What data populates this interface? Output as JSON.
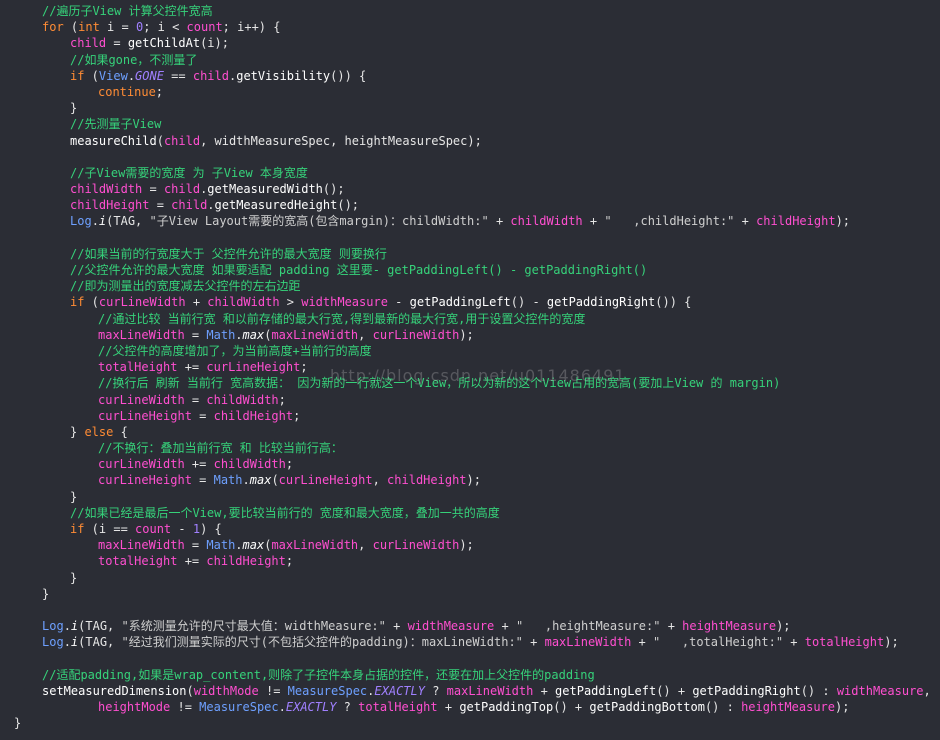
{
  "editor": {
    "watermark": "http://blog.csdn.net/u011486491",
    "lines": [
      {
        "indent": 1,
        "tokens": [
          {
            "t": "cmt",
            "v": "//遍历子View 计算父控件宽高"
          }
        ]
      },
      {
        "indent": 1,
        "tokens": [
          {
            "t": "kw",
            "v": "for"
          },
          {
            "t": "punc",
            "v": " ("
          },
          {
            "t": "kw",
            "v": "int"
          },
          {
            "t": "punc",
            "v": " i = "
          },
          {
            "t": "num",
            "v": "0"
          },
          {
            "t": "punc",
            "v": "; i < "
          },
          {
            "t": "var",
            "v": "count"
          },
          {
            "t": "punc",
            "v": "; i++) {"
          }
        ]
      },
      {
        "indent": 2,
        "tokens": [
          {
            "t": "var",
            "v": "child"
          },
          {
            "t": "punc",
            "v": " = "
          },
          {
            "t": "fn",
            "v": "getChildAt"
          },
          {
            "t": "punc",
            "v": "(i);"
          }
        ]
      },
      {
        "indent": 2,
        "tokens": [
          {
            "t": "cmt",
            "v": "//如果gone，不测量了"
          }
        ]
      },
      {
        "indent": 2,
        "tokens": [
          {
            "t": "kw",
            "v": "if"
          },
          {
            "t": "punc",
            "v": " ("
          },
          {
            "t": "cls",
            "v": "View"
          },
          {
            "t": "punc",
            "v": "."
          },
          {
            "t": "const",
            "v": "GONE"
          },
          {
            "t": "punc",
            "v": " == "
          },
          {
            "t": "var",
            "v": "child"
          },
          {
            "t": "punc",
            "v": "."
          },
          {
            "t": "fn",
            "v": "getVisibility"
          },
          {
            "t": "punc",
            "v": "()) {"
          }
        ]
      },
      {
        "indent": 3,
        "tokens": [
          {
            "t": "kw",
            "v": "continue"
          },
          {
            "t": "punc",
            "v": ";"
          }
        ]
      },
      {
        "indent": 2,
        "tokens": [
          {
            "t": "punc",
            "v": "}"
          }
        ]
      },
      {
        "indent": 2,
        "tokens": [
          {
            "t": "cmt",
            "v": "//先测量子View"
          }
        ]
      },
      {
        "indent": 2,
        "tokens": [
          {
            "t": "fn",
            "v": "measureChild"
          },
          {
            "t": "punc",
            "v": "("
          },
          {
            "t": "var",
            "v": "child"
          },
          {
            "t": "punc",
            "v": ", widthMeasureSpec, heightMeasureSpec);"
          }
        ]
      },
      {
        "indent": 2,
        "tokens": []
      },
      {
        "indent": 2,
        "tokens": [
          {
            "t": "cmt",
            "v": "//子View需要的宽度 为 子View 本身宽度"
          }
        ]
      },
      {
        "indent": 2,
        "tokens": [
          {
            "t": "var",
            "v": "childWidth"
          },
          {
            "t": "punc",
            "v": " = "
          },
          {
            "t": "var",
            "v": "child"
          },
          {
            "t": "punc",
            "v": "."
          },
          {
            "t": "fn",
            "v": "getMeasuredWidth"
          },
          {
            "t": "punc",
            "v": "();"
          }
        ]
      },
      {
        "indent": 2,
        "tokens": [
          {
            "t": "var",
            "v": "childHeight"
          },
          {
            "t": "punc",
            "v": " = "
          },
          {
            "t": "var",
            "v": "child"
          },
          {
            "t": "punc",
            "v": "."
          },
          {
            "t": "fn",
            "v": "getMeasuredHeight"
          },
          {
            "t": "punc",
            "v": "();"
          }
        ]
      },
      {
        "indent": 2,
        "tokens": [
          {
            "t": "cls",
            "v": "Log"
          },
          {
            "t": "punc",
            "v": "."
          },
          {
            "t": "fnit",
            "v": "i"
          },
          {
            "t": "punc",
            "v": "(TAG, "
          },
          {
            "t": "str",
            "v": "\"子View Layout需要的宽高(包含margin)：childWidth:\""
          },
          {
            "t": "punc",
            "v": " + "
          },
          {
            "t": "var",
            "v": "childWidth"
          },
          {
            "t": "punc",
            "v": " + "
          },
          {
            "t": "str",
            "v": "\"   ,childHeight:\""
          },
          {
            "t": "punc",
            "v": " + "
          },
          {
            "t": "var",
            "v": "childHeight"
          },
          {
            "t": "punc",
            "v": ");"
          }
        ]
      },
      {
        "indent": 2,
        "tokens": []
      },
      {
        "indent": 2,
        "tokens": [
          {
            "t": "cmt",
            "v": "//如果当前的行宽度大于 父控件允许的最大宽度 则要换行"
          }
        ]
      },
      {
        "indent": 2,
        "tokens": [
          {
            "t": "cmt",
            "v": "//父控件允许的最大宽度 如果要适配 padding 这里要- getPaddingLeft() - getPaddingRight()"
          }
        ]
      },
      {
        "indent": 2,
        "tokens": [
          {
            "t": "cmt",
            "v": "//即为测量出的宽度减去父控件的左右边距"
          }
        ]
      },
      {
        "indent": 2,
        "tokens": [
          {
            "t": "kw",
            "v": "if"
          },
          {
            "t": "punc",
            "v": " ("
          },
          {
            "t": "var",
            "v": "curLineWidth"
          },
          {
            "t": "punc",
            "v": " + "
          },
          {
            "t": "var",
            "v": "childWidth"
          },
          {
            "t": "punc",
            "v": " > "
          },
          {
            "t": "var",
            "v": "widthMeasure"
          },
          {
            "t": "punc",
            "v": " - "
          },
          {
            "t": "fn",
            "v": "getPaddingLeft"
          },
          {
            "t": "punc",
            "v": "() - "
          },
          {
            "t": "fn",
            "v": "getPaddingRight"
          },
          {
            "t": "punc",
            "v": "()) {"
          }
        ]
      },
      {
        "indent": 3,
        "tokens": [
          {
            "t": "cmt",
            "v": "//通过比较 当前行宽 和以前存储的最大行宽,得到最新的最大行宽,用于设置父控件的宽度"
          }
        ]
      },
      {
        "indent": 3,
        "tokens": [
          {
            "t": "var",
            "v": "maxLineWidth"
          },
          {
            "t": "punc",
            "v": " = "
          },
          {
            "t": "cls",
            "v": "Math"
          },
          {
            "t": "punc",
            "v": "."
          },
          {
            "t": "fnit",
            "v": "max"
          },
          {
            "t": "punc",
            "v": "("
          },
          {
            "t": "var",
            "v": "maxLineWidth"
          },
          {
            "t": "punc",
            "v": ", "
          },
          {
            "t": "var",
            "v": "curLineWidth"
          },
          {
            "t": "punc",
            "v": ");"
          }
        ]
      },
      {
        "indent": 3,
        "tokens": [
          {
            "t": "cmt",
            "v": "//父控件的高度增加了，为当前高度+当前行的高度"
          }
        ]
      },
      {
        "indent": 3,
        "tokens": [
          {
            "t": "var",
            "v": "totalHeight"
          },
          {
            "t": "punc",
            "v": " += "
          },
          {
            "t": "var",
            "v": "curLineHeight"
          },
          {
            "t": "punc",
            "v": ";"
          }
        ]
      },
      {
        "indent": 3,
        "tokens": [
          {
            "t": "cmt",
            "v": "//换行后 刷新 当前行 宽高数据： 因为新的一行就这一个View，所以为新的这个View占用的宽高(要加上View 的 margin)"
          }
        ]
      },
      {
        "indent": 3,
        "tokens": [
          {
            "t": "var",
            "v": "curLineWidth"
          },
          {
            "t": "punc",
            "v": " = "
          },
          {
            "t": "var",
            "v": "childWidth"
          },
          {
            "t": "punc",
            "v": ";"
          }
        ]
      },
      {
        "indent": 3,
        "tokens": [
          {
            "t": "var",
            "v": "curLineHeight"
          },
          {
            "t": "punc",
            "v": " = "
          },
          {
            "t": "var",
            "v": "childHeight"
          },
          {
            "t": "punc",
            "v": ";"
          }
        ]
      },
      {
        "indent": 2,
        "tokens": [
          {
            "t": "punc",
            "v": "} "
          },
          {
            "t": "kw",
            "v": "else"
          },
          {
            "t": "punc",
            "v": " {"
          }
        ]
      },
      {
        "indent": 3,
        "tokens": [
          {
            "t": "cmt",
            "v": "//不换行：叠加当前行宽 和 比较当前行高："
          }
        ]
      },
      {
        "indent": 3,
        "tokens": [
          {
            "t": "var",
            "v": "curLineWidth"
          },
          {
            "t": "punc",
            "v": " += "
          },
          {
            "t": "var",
            "v": "childWidth"
          },
          {
            "t": "punc",
            "v": ";"
          }
        ]
      },
      {
        "indent": 3,
        "tokens": [
          {
            "t": "var",
            "v": "curLineHeight"
          },
          {
            "t": "punc",
            "v": " = "
          },
          {
            "t": "cls",
            "v": "Math"
          },
          {
            "t": "punc",
            "v": "."
          },
          {
            "t": "fnit",
            "v": "max"
          },
          {
            "t": "punc",
            "v": "("
          },
          {
            "t": "var",
            "v": "curLineHeight"
          },
          {
            "t": "punc",
            "v": ", "
          },
          {
            "t": "var",
            "v": "childHeight"
          },
          {
            "t": "punc",
            "v": ");"
          }
        ]
      },
      {
        "indent": 2,
        "tokens": [
          {
            "t": "punc",
            "v": "}"
          }
        ]
      },
      {
        "indent": 2,
        "tokens": [
          {
            "t": "cmt",
            "v": "//如果已经是最后一个View,要比较当前行的 宽度和最大宽度，叠加一共的高度"
          }
        ]
      },
      {
        "indent": 2,
        "tokens": [
          {
            "t": "kw",
            "v": "if"
          },
          {
            "t": "punc",
            "v": " (i == "
          },
          {
            "t": "var",
            "v": "count"
          },
          {
            "t": "punc",
            "v": " - "
          },
          {
            "t": "num",
            "v": "1"
          },
          {
            "t": "punc",
            "v": ") {"
          }
        ]
      },
      {
        "indent": 3,
        "tokens": [
          {
            "t": "var",
            "v": "maxLineWidth"
          },
          {
            "t": "punc",
            "v": " = "
          },
          {
            "t": "cls",
            "v": "Math"
          },
          {
            "t": "punc",
            "v": "."
          },
          {
            "t": "fnit",
            "v": "max"
          },
          {
            "t": "punc",
            "v": "("
          },
          {
            "t": "var",
            "v": "maxLineWidth"
          },
          {
            "t": "punc",
            "v": ", "
          },
          {
            "t": "var",
            "v": "curLineWidth"
          },
          {
            "t": "punc",
            "v": ");"
          }
        ]
      },
      {
        "indent": 3,
        "tokens": [
          {
            "t": "var",
            "v": "totalHeight"
          },
          {
            "t": "punc",
            "v": " += "
          },
          {
            "t": "var",
            "v": "childHeight"
          },
          {
            "t": "punc",
            "v": ";"
          }
        ]
      },
      {
        "indent": 2,
        "tokens": [
          {
            "t": "punc",
            "v": "}"
          }
        ]
      },
      {
        "indent": 1,
        "tokens": [
          {
            "t": "punc",
            "v": "}"
          }
        ]
      },
      {
        "indent": 1,
        "tokens": []
      },
      {
        "indent": 1,
        "tokens": [
          {
            "t": "cls",
            "v": "Log"
          },
          {
            "t": "punc",
            "v": "."
          },
          {
            "t": "fnit",
            "v": "i"
          },
          {
            "t": "punc",
            "v": "(TAG, "
          },
          {
            "t": "str",
            "v": "\"系统测量允许的尺寸最大值：widthMeasure:\""
          },
          {
            "t": "punc",
            "v": " + "
          },
          {
            "t": "var",
            "v": "widthMeasure"
          },
          {
            "t": "punc",
            "v": " + "
          },
          {
            "t": "str",
            "v": "\"   ,heightMeasure:\""
          },
          {
            "t": "punc",
            "v": " + "
          },
          {
            "t": "var",
            "v": "heightMeasure"
          },
          {
            "t": "punc",
            "v": ");"
          }
        ]
      },
      {
        "indent": 1,
        "tokens": [
          {
            "t": "cls",
            "v": "Log"
          },
          {
            "t": "punc",
            "v": "."
          },
          {
            "t": "fnit",
            "v": "i"
          },
          {
            "t": "punc",
            "v": "(TAG, "
          },
          {
            "t": "str",
            "v": "\"经过我们测量实际的尺寸(不包括父控件的padding)：maxLineWidth:\""
          },
          {
            "t": "punc",
            "v": " + "
          },
          {
            "t": "var",
            "v": "maxLineWidth"
          },
          {
            "t": "punc",
            "v": " + "
          },
          {
            "t": "str",
            "v": "\"   ,totalHeight:\""
          },
          {
            "t": "punc",
            "v": " + "
          },
          {
            "t": "var",
            "v": "totalHeight"
          },
          {
            "t": "punc",
            "v": ");"
          }
        ]
      },
      {
        "indent": 1,
        "tokens": []
      },
      {
        "indent": 1,
        "tokens": [
          {
            "t": "cmt",
            "v": "//适配padding,如果是wrap_content,则除了子控件本身占据的控件，还要在加上父控件的padding"
          }
        ]
      },
      {
        "indent": 1,
        "tokens": [
          {
            "t": "fn",
            "v": "setMeasuredDimension"
          },
          {
            "t": "punc",
            "v": "("
          },
          {
            "t": "var",
            "v": "widthMode"
          },
          {
            "t": "punc",
            "v": " != "
          },
          {
            "t": "cls",
            "v": "MeasureSpec"
          },
          {
            "t": "punc",
            "v": "."
          },
          {
            "t": "const",
            "v": "EXACTLY"
          },
          {
            "t": "punc",
            "v": " ? "
          },
          {
            "t": "var",
            "v": "maxLineWidth"
          },
          {
            "t": "punc",
            "v": " + "
          },
          {
            "t": "fn",
            "v": "getPaddingLeft"
          },
          {
            "t": "punc",
            "v": "() + "
          },
          {
            "t": "fn",
            "v": "getPaddingRight"
          },
          {
            "t": "punc",
            "v": "() : "
          },
          {
            "t": "var",
            "v": "widthMeasure"
          },
          {
            "t": "punc",
            "v": ","
          }
        ]
      },
      {
        "indent": 3,
        "tokens": [
          {
            "t": "var",
            "v": "heightMode"
          },
          {
            "t": "punc",
            "v": " != "
          },
          {
            "t": "cls",
            "v": "MeasureSpec"
          },
          {
            "t": "punc",
            "v": "."
          },
          {
            "t": "const",
            "v": "EXACTLY"
          },
          {
            "t": "punc",
            "v": " ? "
          },
          {
            "t": "var",
            "v": "totalHeight"
          },
          {
            "t": "punc",
            "v": " + "
          },
          {
            "t": "fn",
            "v": "getPaddingTop"
          },
          {
            "t": "punc",
            "v": "() + "
          },
          {
            "t": "fn",
            "v": "getPaddingBottom"
          },
          {
            "t": "punc",
            "v": "() : "
          },
          {
            "t": "var",
            "v": "heightMeasure"
          },
          {
            "t": "punc",
            "v": ");"
          }
        ]
      },
      {
        "indent": 0,
        "tokens": [
          {
            "t": "punc",
            "v": "}"
          }
        ]
      }
    ]
  }
}
